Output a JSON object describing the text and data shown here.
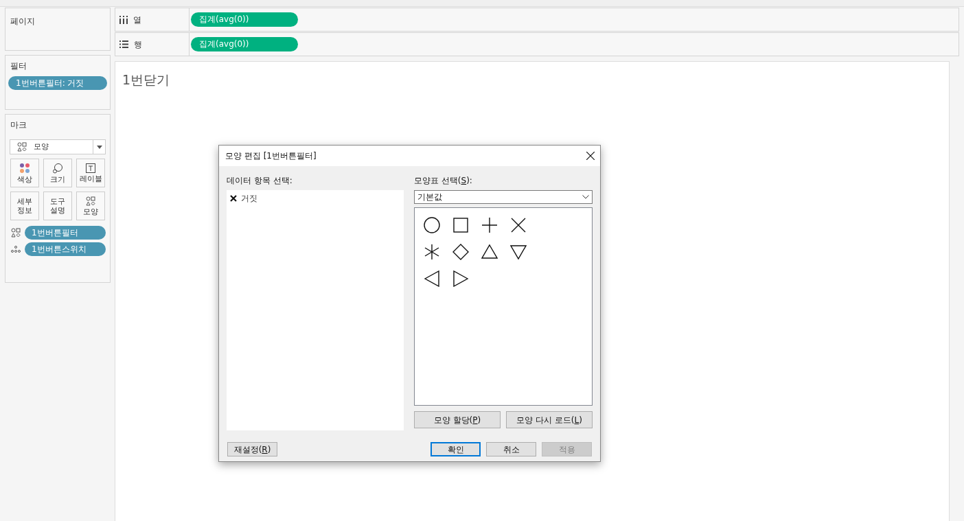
{
  "sidebar": {
    "pages": {
      "title": "페이지"
    },
    "filters": {
      "title": "필터",
      "pills": [
        "1번버튼필터: 거짓"
      ]
    },
    "marks": {
      "title": "마크",
      "mark_type": "모양",
      "buttons": [
        {
          "kind": "color",
          "label": "색상"
        },
        {
          "kind": "size",
          "label": "크기"
        },
        {
          "kind": "label",
          "label": "레이블"
        },
        {
          "kind": "detail",
          "label": "세부\n정보"
        },
        {
          "kind": "tooltip",
          "label": "도구\n설명"
        },
        {
          "kind": "shape",
          "label": "모양"
        }
      ],
      "fields": [
        {
          "kind": "shape",
          "label": "1번버튼필터"
        },
        {
          "kind": "detail",
          "label": "1번버튼스위치"
        }
      ]
    }
  },
  "shelves": [
    {
      "kind": "columns",
      "label": "열",
      "pill": "집계(avg(0))"
    },
    {
      "kind": "rows",
      "label": "행",
      "pill": "집계(avg(0))"
    }
  ],
  "sheet": {
    "title": "1번닫기"
  },
  "dialog": {
    "title": "모양 편집 [1번버튼필터]",
    "data_items": {
      "label": "데이터 항목 선택:",
      "items": [
        {
          "label": "거짓",
          "selected": false
        }
      ]
    },
    "palette": {
      "label": "모양표 선택(",
      "key": "S",
      "tail": "):",
      "value": "기본값"
    },
    "shapes": [
      {
        "kind": "circle"
      },
      {
        "kind": "square"
      },
      {
        "kind": "plus"
      },
      {
        "kind": "cross"
      },
      {
        "kind": "asterisk"
      },
      {
        "kind": "diamond"
      },
      {
        "kind": "triangle-up"
      },
      {
        "kind": "triangle-down"
      },
      {
        "kind": "triangle-left"
      },
      {
        "kind": "triangle-right"
      }
    ],
    "palette_buttons": [
      {
        "label": "모양 할당(",
        "key": "P",
        "tail": ")"
      },
      {
        "label": "모양 다시 로드(",
        "key": "L",
        "tail": ")"
      }
    ],
    "reset": {
      "label": "재설정(",
      "key": "R",
      "tail": ")"
    },
    "buttons": [
      {
        "label": "확인",
        "default": true,
        "disabled": false
      },
      {
        "label": "취소",
        "default": false,
        "disabled": false
      },
      {
        "label": "적용",
        "default": false,
        "disabled": true
      }
    ]
  }
}
